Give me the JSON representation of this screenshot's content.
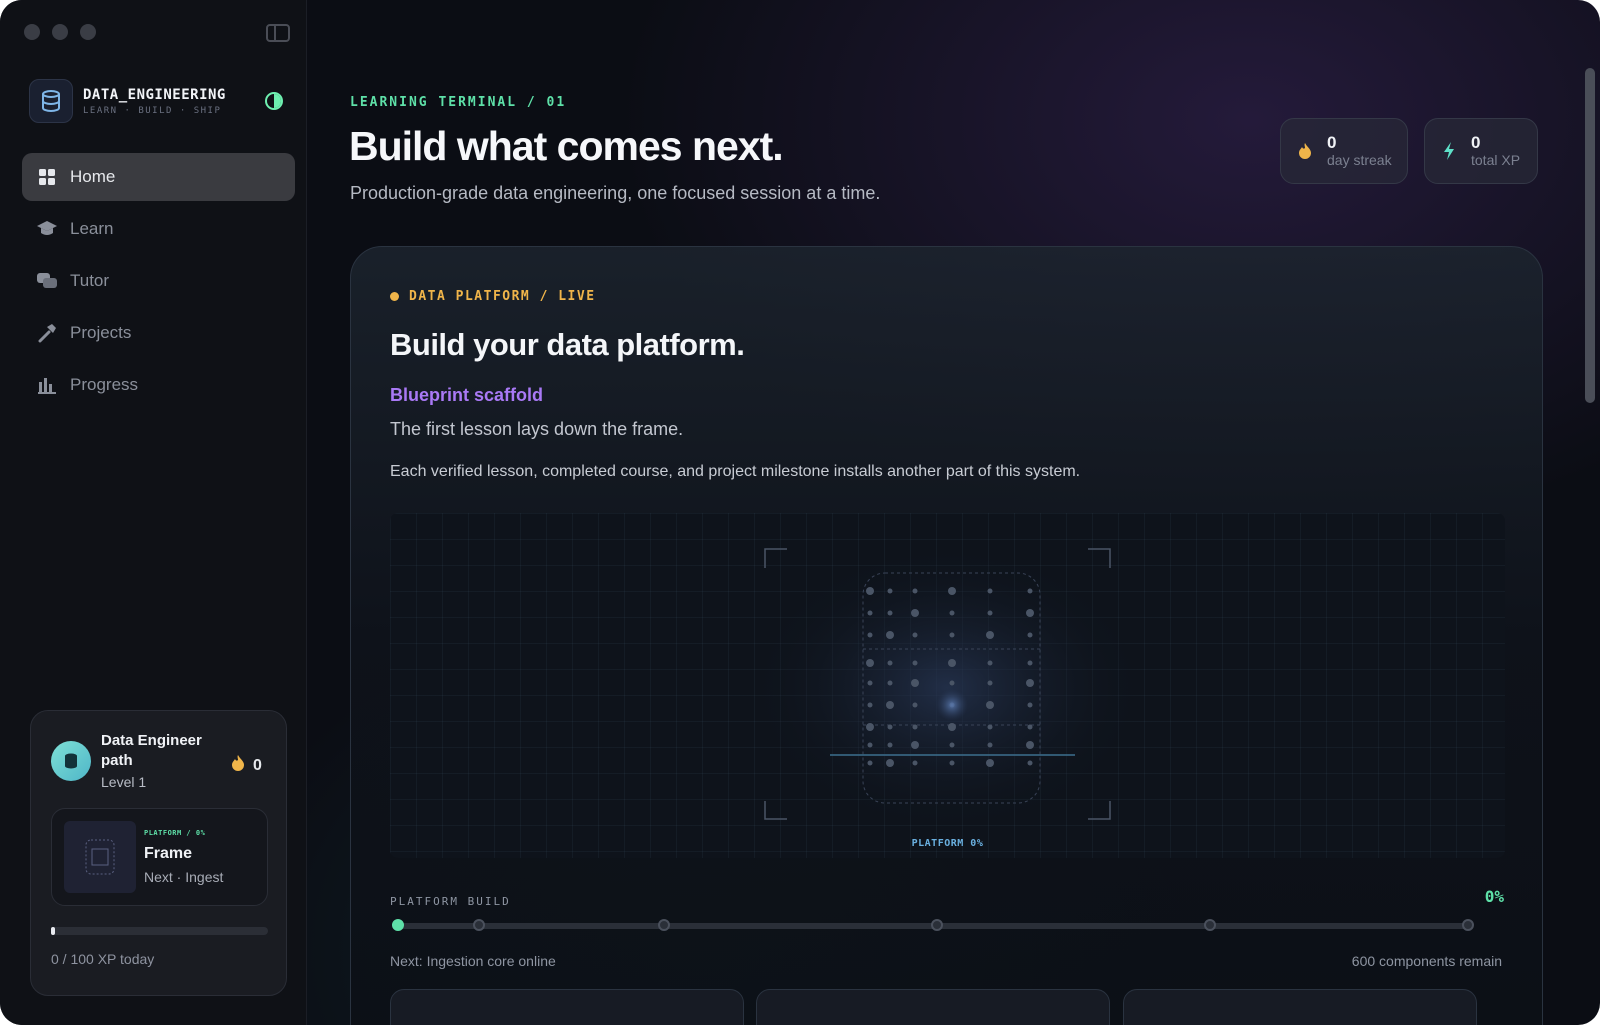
{
  "sidebar": {
    "brand": {
      "name": "DATA_ENGINEERING",
      "tagline": "LEARN · BUILD · SHIP"
    },
    "nav": [
      {
        "label": "Home",
        "icon": "grid-icon",
        "active": true
      },
      {
        "label": "Learn",
        "icon": "graduation-cap-icon",
        "active": false
      },
      {
        "label": "Tutor",
        "icon": "chat-bubbles-icon",
        "active": false
      },
      {
        "label": "Projects",
        "icon": "hammer-icon",
        "active": false
      },
      {
        "label": "Progress",
        "icon": "bar-chart-icon",
        "active": false
      }
    ],
    "path_card": {
      "title": "Data Engineer path",
      "level": "Level 1",
      "streak": "0",
      "frame": {
        "kicker": "PLATFORM / 0%",
        "name": "Frame",
        "next": "Next · Ingest"
      },
      "xp_progress": 0,
      "xp_text": "0 / 100 XP today"
    }
  },
  "header": {
    "kicker": "LEARNING TERMINAL / 01",
    "title": "Build what comes next.",
    "subtitle": "Production-grade data engineering, one focused session at a time.",
    "stats": [
      {
        "value": "0",
        "label": "day streak",
        "icon": "flame-icon"
      },
      {
        "value": "0",
        "label": "total XP",
        "icon": "bolt-icon"
      }
    ]
  },
  "platform": {
    "kicker": "DATA PLATFORM / LIVE",
    "title": "Build your data platform.",
    "stage_name": "Blueprint scaffold",
    "stage_desc": "The first lesson lays down the frame.",
    "description": "Each verified lesson, completed course, and project milestone installs another part of this system.",
    "blueprint_caption": "PLATFORM 0%",
    "build_label": "PLATFORM BUILD",
    "build_percent": "0%",
    "build_progress": 0,
    "next_label": "Next: Ingestion core online",
    "remaining_label": "600 components remain"
  },
  "colors": {
    "accent_green": "#5ee0a8",
    "accent_amber": "#f0b54a",
    "accent_purple": "#a979f5"
  }
}
